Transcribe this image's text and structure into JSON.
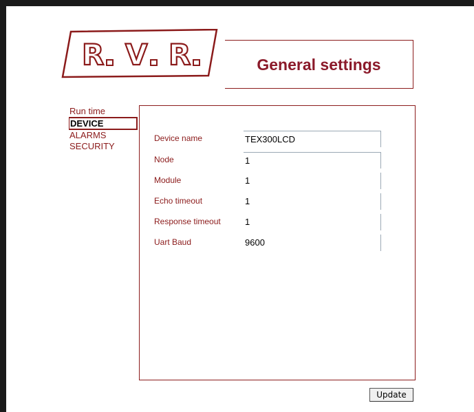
{
  "logo": {
    "text": "R.V.R.",
    "brand_color": "#8b1a1a"
  },
  "header": {
    "title": "General settings"
  },
  "nav": {
    "items": [
      {
        "label": "Run time",
        "active": false
      },
      {
        "label": "DEVICE",
        "active": true
      },
      {
        "label": "ALARMS",
        "active": false
      },
      {
        "label": "SECURITY",
        "active": false
      }
    ]
  },
  "settings": {
    "rows": [
      {
        "label": "Device name",
        "value": "TEX300LCD"
      },
      {
        "label": "Node",
        "value": "1"
      },
      {
        "label": "Module",
        "value": "1"
      },
      {
        "label": "Echo timeout",
        "value": "1"
      },
      {
        "label": "Response timeout",
        "value": "1"
      },
      {
        "label": "Uart Baud",
        "value": "9600"
      }
    ]
  },
  "actions": {
    "update_label": "Update"
  },
  "colors": {
    "accent": "#8b1a1a",
    "frame": "#1a1a1a",
    "field_border": "#9aa8b4"
  }
}
